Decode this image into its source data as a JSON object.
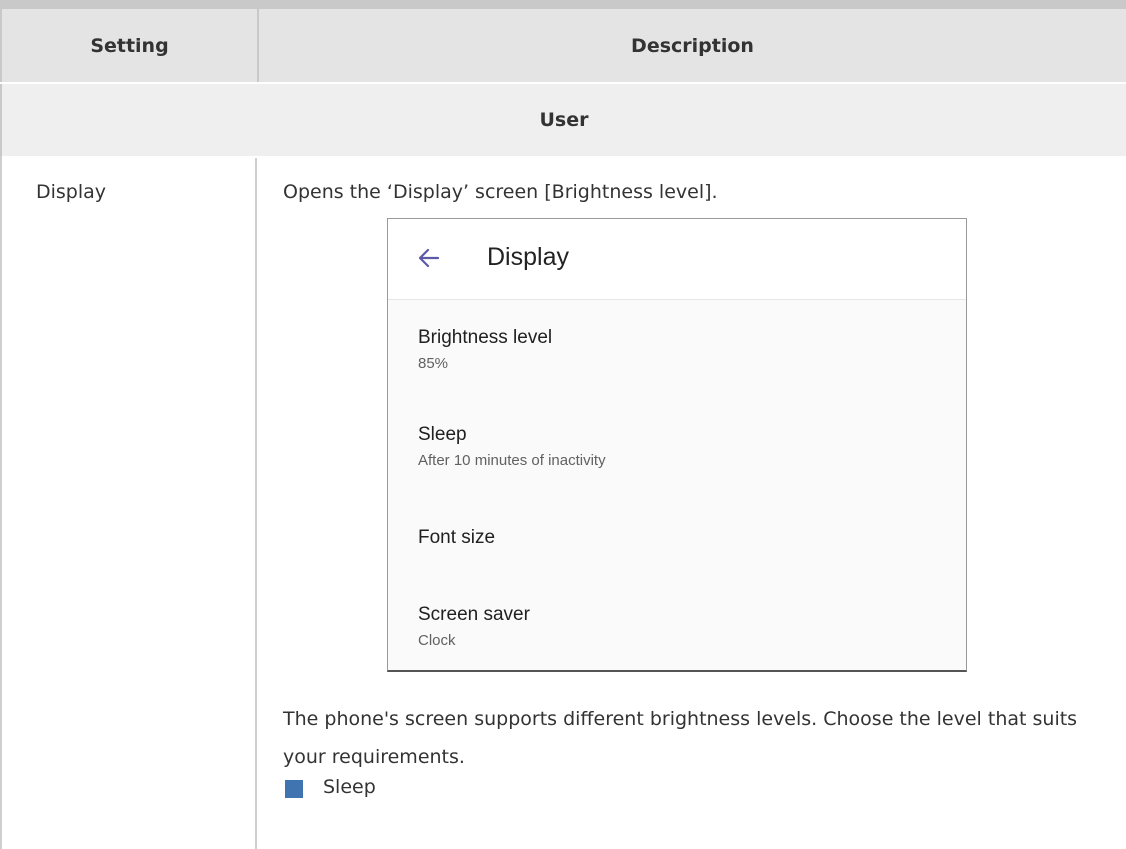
{
  "table": {
    "header": {
      "setting": "Setting",
      "description": "Description"
    },
    "section": "User",
    "row": {
      "setting": "Display",
      "intro": "Opens the ‘Display’ screen [Brightness level].",
      "paragraph": "The phone's screen supports different brightness levels. Choose the level that suits your requirements.",
      "bullets": [
        "Sleep"
      ]
    }
  },
  "screen": {
    "title": "Display",
    "back_icon": "arrow-left-icon",
    "accent": "#5c5aa8",
    "items": [
      {
        "title": "Brightness level",
        "subtitle": "85%"
      },
      {
        "title": "Sleep",
        "subtitle": "After 10 minutes of inactivity"
      },
      {
        "title": "Font size",
        "subtitle": ""
      },
      {
        "title": "Screen saver",
        "subtitle": "Clock"
      }
    ]
  },
  "colors": {
    "bullet": "#3f74b0",
    "header_bg": "#e4e4e4",
    "section_bg": "#efefef"
  }
}
